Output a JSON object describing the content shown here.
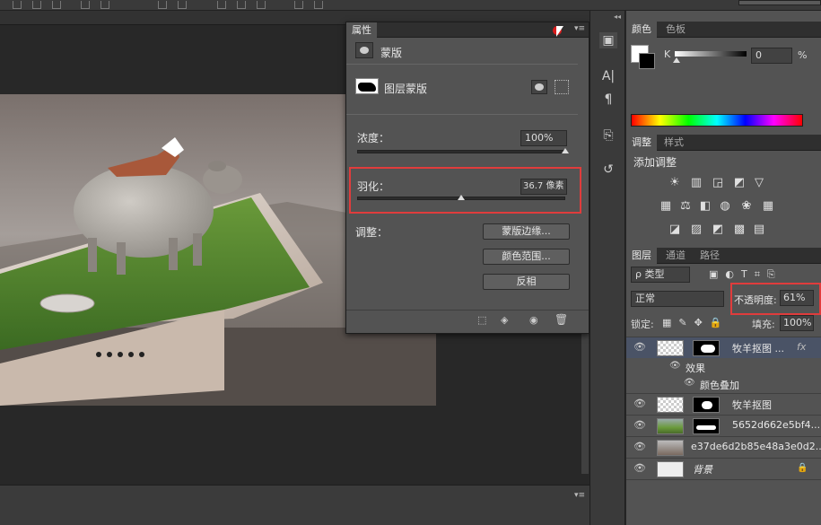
{
  "properties": {
    "tab": "属性",
    "mask_type": "蒙版",
    "layer_mask_label": "图层蒙版",
    "density_label": "浓度：",
    "density_value": "100%",
    "feather_label": "羽化：",
    "feather_value": "36.7 像素",
    "adjust_label": "调整：",
    "buttons": {
      "mask_edge": "蒙版边缘...",
      "color_range": "颜色范围...",
      "invert": "反相"
    }
  },
  "color_panel": {
    "tabs": [
      "颜色",
      "色板"
    ],
    "channel_label": "K",
    "k_value": "0",
    "k_unit": "%"
  },
  "adjustments": {
    "tabs": [
      "调整",
      "样式"
    ],
    "title": "添加调整"
  },
  "layers": {
    "tabs": [
      "图层",
      "通道",
      "路径"
    ],
    "filter_label": "ρ 类型",
    "blend_mode": "正常",
    "opacity_label": "不透明度:",
    "opacity_value": "61%",
    "lock_label": "锁定:",
    "fill_label": "填充:",
    "fill_value": "100%",
    "items": [
      {
        "name": "牧羊抠图 ...",
        "fx": "fx"
      },
      {
        "name": "效果"
      },
      {
        "name": "颜色叠加"
      },
      {
        "name": "牧羊抠图"
      },
      {
        "name": "5652d662e5bf4..."
      },
      {
        "name": "e37de6d2b85e48a3e0d2..."
      },
      {
        "name": "背景"
      }
    ]
  },
  "colors": {
    "highlight": "#e03c3c",
    "panel_bg": "#535353"
  }
}
